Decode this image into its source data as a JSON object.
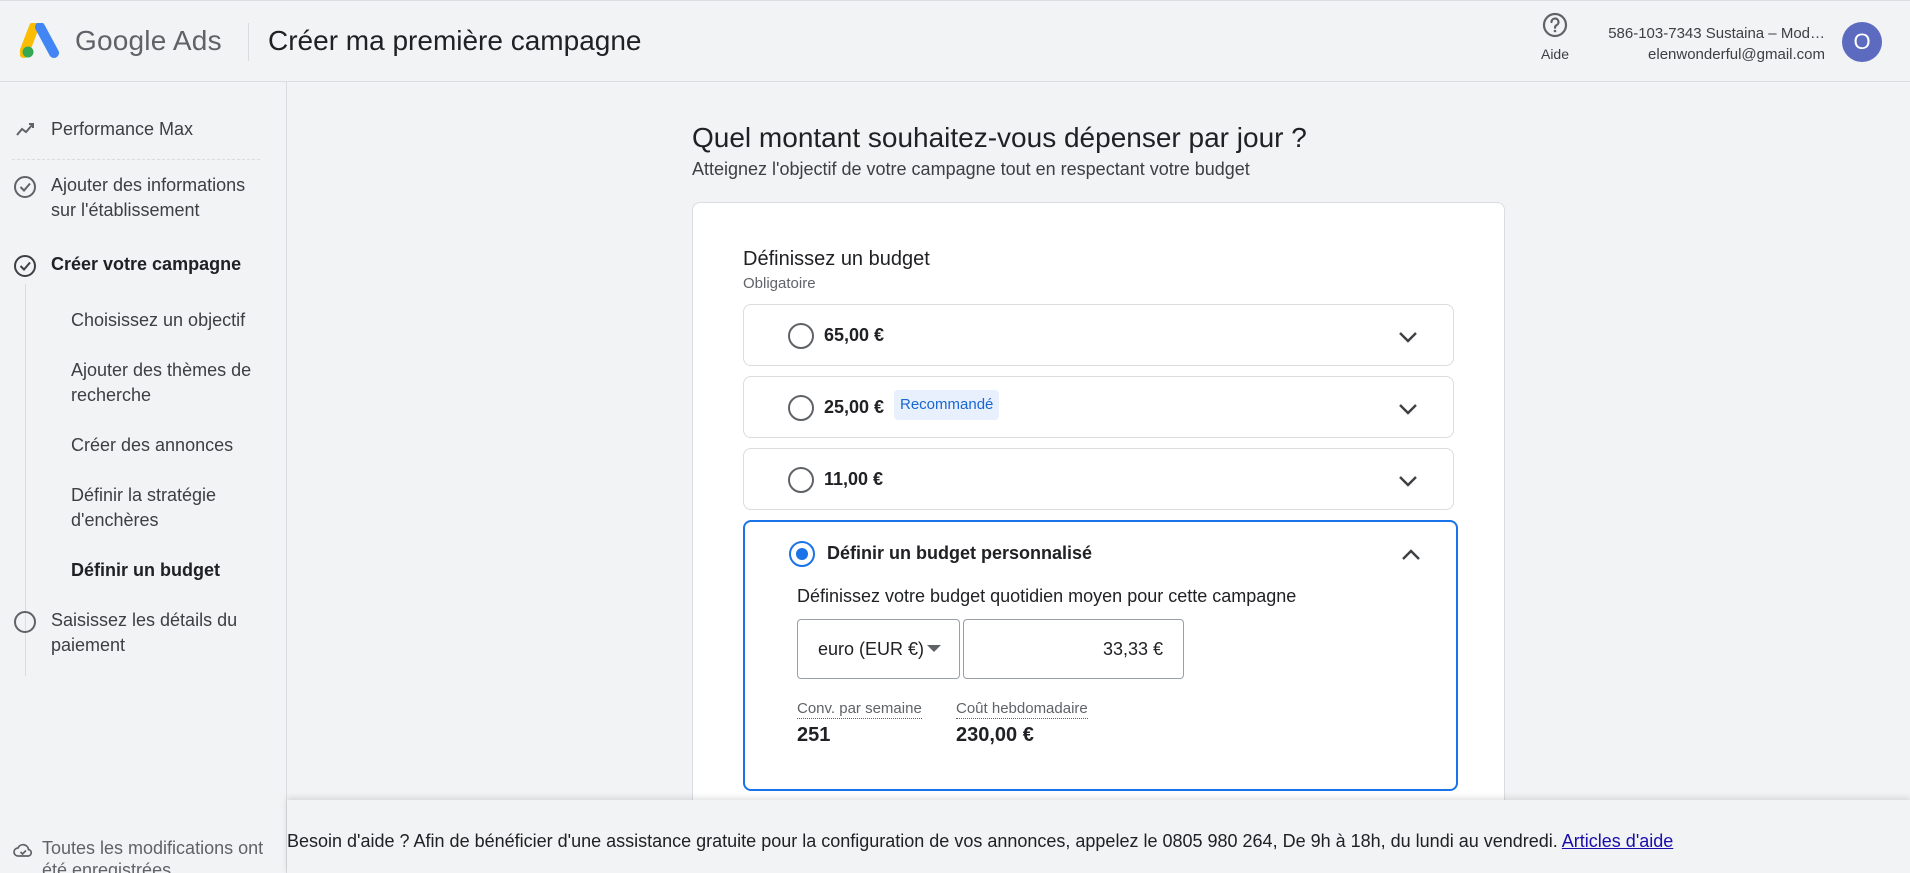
{
  "header": {
    "brand": "Google Ads",
    "title": "Créer ma première campagne",
    "help_label": "Aide",
    "account_line1": "586-103-7343 Sustaina – Mod…",
    "account_line2": "elenwonderful@gmail.com",
    "avatar_letter": "O"
  },
  "sidebar": {
    "items": [
      {
        "label": "Performance Max",
        "icon": "chart-icon"
      },
      {
        "label": "Ajouter des informations sur l'établissement",
        "icon": "check-circle-icon"
      },
      {
        "label": "Créer votre campagne",
        "icon": "check-circle-icon"
      },
      {
        "label": "Saisissez les détails du paiement",
        "icon": "circle-icon"
      }
    ],
    "sub_items": [
      "Choisissez un objectif",
      "Ajouter des thèmes de recherche",
      "Créer des annonces",
      "Définir la stratégie d'enchères",
      "Définir un budget"
    ],
    "saved_status": "Toutes les modifications ont été enregistrées"
  },
  "main": {
    "question": "Quel montant souhaitez-vous dépenser par jour ?",
    "subtitle": "Atteignez l'objectif de votre campagne tout en respectant votre budget",
    "card": {
      "title": "Définissez un budget",
      "required": "Obligatoire",
      "options": [
        {
          "label": "65,00 €"
        },
        {
          "label": "25,00 €",
          "badge": "Recommandé"
        },
        {
          "label": "11,00 €"
        }
      ],
      "custom": {
        "label": "Définir un budget personnalisé",
        "description": "Définissez votre budget quotidien moyen pour cette campagne",
        "currency": "euro (EUR €)",
        "amount": "33,33 €",
        "stats": [
          {
            "label": "Conv. par semaine",
            "value": "251"
          },
          {
            "label": "Coût hebdomadaire",
            "value": "230,00 €"
          }
        ]
      }
    }
  },
  "footer": {
    "text": "Besoin d'aide ? Afin de bénéficier d'une assistance gratuite pour la configuration de vos annonces, appelez le 0805 980 264, De 9h à 18h, du lundi au vendredi.",
    "link": "Articles d'aide"
  },
  "colors": {
    "accent": "#1a73e8",
    "avatar": "#5c6bc0",
    "badge_bg": "#e8f0fe"
  }
}
